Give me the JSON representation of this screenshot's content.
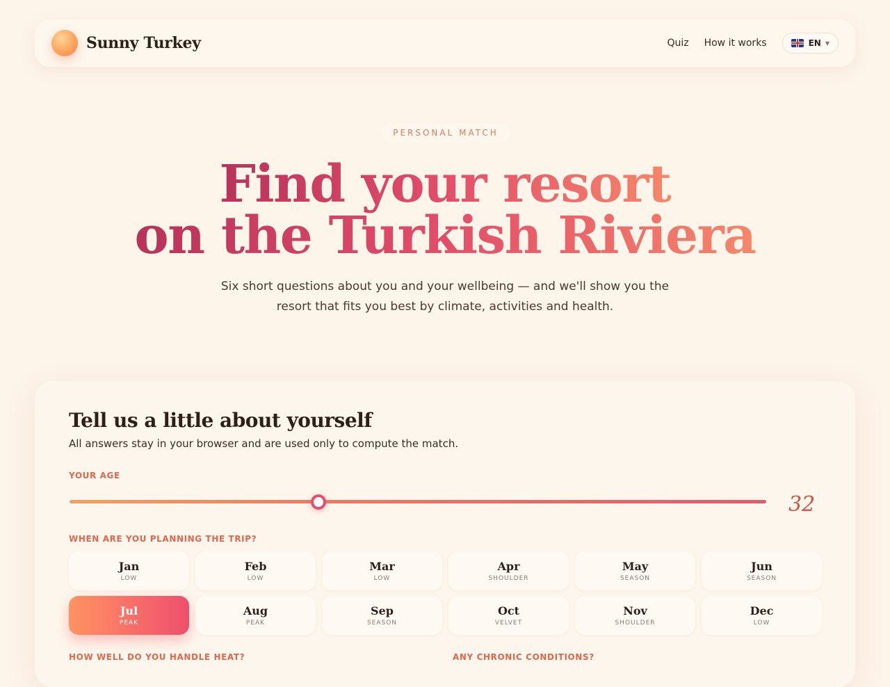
{
  "header": {
    "brand": "Sunny Turkey",
    "nav": [
      {
        "label": "Quiz"
      },
      {
        "label": "How it works"
      }
    ],
    "language": "EN",
    "language_flag": "uk-flag-icon"
  },
  "hero": {
    "eyebrow": "PERSONAL MATCH",
    "title_line1_a": "Find ",
    "title_line1_b": "your resort",
    "title_line2_a": "on the ",
    "title_line2_b": "Turkish Riviera",
    "subtitle": "Six short questions about you and your wellbeing — and we'll show you the resort that fits you best by climate, activities and health."
  },
  "quiz": {
    "title": "Tell us a little about yourself",
    "subtitle": "All answers stay in your browser and are used only to compute the match.",
    "age_label": "YOUR AGE",
    "age_value": "32",
    "age_fraction": 0.357,
    "trip_label": "WHEN ARE YOU PLANNING THE TRIP?",
    "months": [
      {
        "name": "Jan",
        "tag": "LOW",
        "active": false
      },
      {
        "name": "Feb",
        "tag": "LOW",
        "active": false
      },
      {
        "name": "Mar",
        "tag": "LOW",
        "active": false
      },
      {
        "name": "Apr",
        "tag": "SHOULDER",
        "active": false
      },
      {
        "name": "May",
        "tag": "SEASON",
        "active": false
      },
      {
        "name": "Jun",
        "tag": "SEASON",
        "active": false
      },
      {
        "name": "Jul",
        "tag": "PEAK",
        "active": true
      },
      {
        "name": "Aug",
        "tag": "PEAK",
        "active": false
      },
      {
        "name": "Sep",
        "tag": "SEASON",
        "active": false
      },
      {
        "name": "Oct",
        "tag": "VELVET",
        "active": false
      },
      {
        "name": "Nov",
        "tag": "SHOULDER",
        "active": false
      },
      {
        "name": "Dec",
        "tag": "LOW",
        "active": false
      }
    ],
    "heat_label": "HOW WELL DO YOU HANDLE HEAT?",
    "chronic_label": "ANY CHRONIC CONDITIONS?"
  },
  "colors": {
    "background": "#fdf4ea",
    "accent": "#e2506a",
    "accent_warm": "#f5876a",
    "label": "#e0684e"
  }
}
